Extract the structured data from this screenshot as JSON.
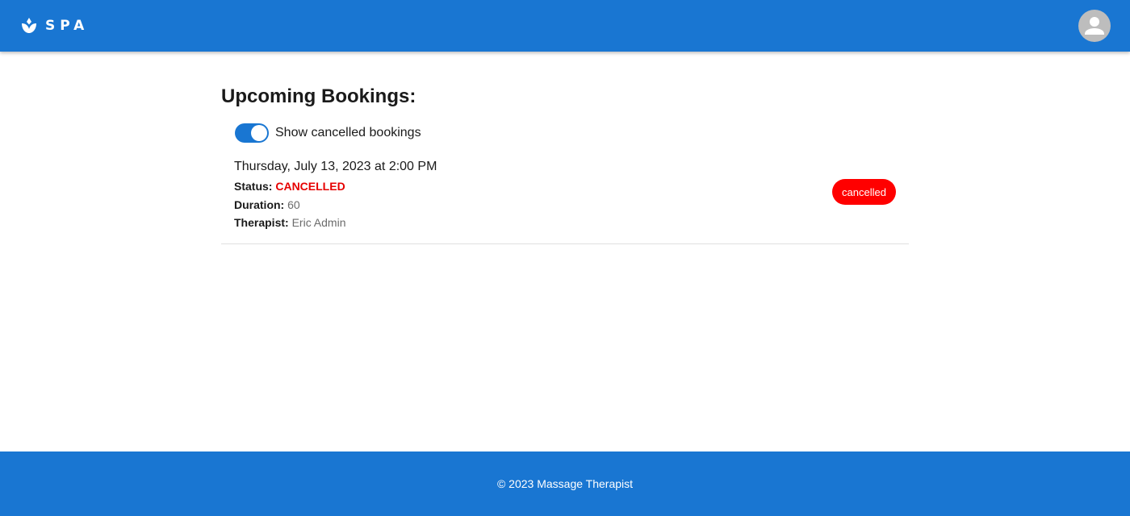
{
  "header": {
    "logo_text": "SPA",
    "logo_icon": "spa-lotus-icon",
    "avatar_icon": "person-icon",
    "colors": {
      "bar": "#1976d2",
      "avatar": "#bdbdbd"
    }
  },
  "main": {
    "title": "Upcoming Bookings:",
    "toggle": {
      "label": "Show cancelled bookings",
      "checked": true
    },
    "bookings": [
      {
        "datetime": "Thursday, July 13, 2023 at 2:00 PM",
        "status_label": "Status:",
        "status": "CANCELLED",
        "duration_label": "Duration:",
        "duration": "60",
        "therapist_label": "Therapist:",
        "therapist": "Eric Admin",
        "chip": "cancelled",
        "chip_color": "#ff0000"
      }
    ]
  },
  "footer": {
    "text": "© 2023 Massage Therapist"
  }
}
